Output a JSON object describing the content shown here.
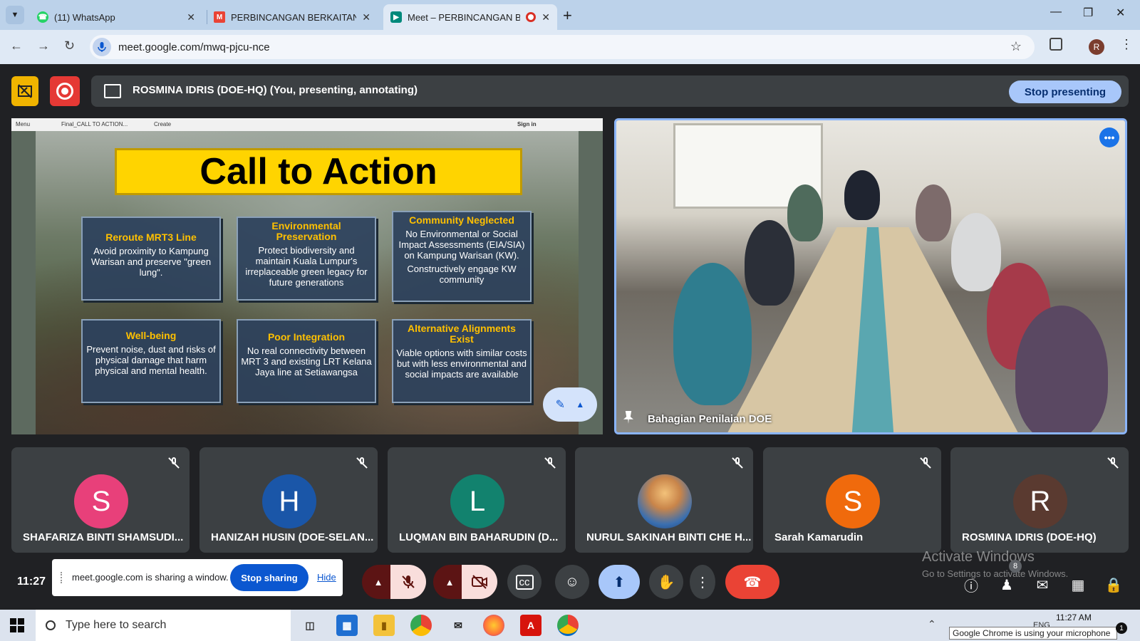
{
  "browser": {
    "tabs": [
      {
        "label": "(11) WhatsApp",
        "icon": "whatsapp-icon"
      },
      {
        "label": "PERBINCANGAN BERKAITAN BA",
        "icon": "gmail-icon"
      },
      {
        "label": "Meet – PERBINCANGAN BE",
        "icon": "meet-icon"
      }
    ],
    "url": "meet.google.com/mwq-pjcu-nce",
    "profile_initial": "R"
  },
  "meet": {
    "presenting_text": "ROSMINA IDRIS (DOE-HQ) (You, presenting, annotating)",
    "stop_presenting": "Stop presenting",
    "slide": {
      "chrome_tab": "Final_CALL TO ACTION...",
      "chrome_menu": "Menu",
      "chrome_create": "Create",
      "chrome_signin": "Sign in",
      "title": "Call to Action",
      "boxes": [
        {
          "heading": "Reroute MRT3 Line",
          "body": "Avoid proximity to Kampung Warisan and preserve \"green lung\"."
        },
        {
          "heading": "Environmental Preservation",
          "body": "Protect biodiversity and maintain Kuala Lumpur's irreplaceable green legacy for future generations"
        },
        {
          "heading": "Community Neglected",
          "body": "No Environmental or Social Impact Assessments (EIA/SIA) on Kampung Warisan (KW).",
          "body2": "Constructively engage KW community"
        },
        {
          "heading": "Well-being",
          "body": "Prevent noise, dust and risks of physical damage that harm physical and mental health."
        },
        {
          "heading": "Poor Integration",
          "body": "No real connectivity between MRT 3 and existing LRT Kelana Jaya line at Setiawangsa"
        },
        {
          "heading": "Alternative Alignments Exist",
          "body": "Viable options with similar costs but with less environmental and social impacts are available"
        }
      ]
    },
    "pinned_video_name": "Bahagian Penilaian DOE",
    "participants": [
      {
        "name": "SHAFARIZA BINTI SHAMSUDI...",
        "initial": "S",
        "color": "#e8407a"
      },
      {
        "name": "HANIZAH HUSIN (DOE-SELAN...",
        "initial": "H",
        "color": "#1a56a8"
      },
      {
        "name": "LUQMAN BIN BAHARUDIN (D...",
        "initial": "L",
        "color": "#12826e"
      },
      {
        "name": "NURUL SAKINAH BINTI CHE H...",
        "initial": "",
        "color": "#c9854a"
      },
      {
        "name": "Sarah Kamarudin",
        "initial": "S",
        "color": "#f06a0c"
      },
      {
        "name": "ROSMINA IDRIS (DOE-HQ)",
        "initial": "R",
        "color": "#5a3a30"
      }
    ],
    "time": "11:27",
    "share_notice": "meet.google.com is sharing a window.",
    "stop_sharing": "Stop sharing",
    "hide": "Hide",
    "people_count": "8"
  },
  "watermark": {
    "line1": "Activate Windows",
    "line2": "Go to Settings to activate Windows."
  },
  "taskbar": {
    "search_placeholder": "Type here to search",
    "clock": "11:27 AM",
    "lang": "ENG",
    "tooltip": "Google Chrome is using your microphone",
    "notifications": "1"
  },
  "colors": {
    "meet_bg": "#202124",
    "accent": "#a8c7fa",
    "slide_heading": "#ffc000",
    "hangup": "#ea4335"
  }
}
